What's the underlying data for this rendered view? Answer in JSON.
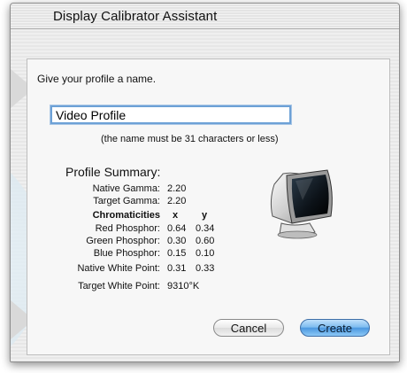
{
  "window": {
    "title": "Display Calibrator Assistant"
  },
  "form": {
    "prompt": "Give your profile a name.",
    "profile_name": "Video Profile",
    "hint": "(the name must be 31 characters or less)"
  },
  "summary": {
    "title": "Profile Summary:",
    "native_gamma_label": "Native Gamma:",
    "native_gamma_value": "2.20",
    "target_gamma_label": "Target Gamma:",
    "target_gamma_value": "2.20",
    "chromaticities_label": "Chromaticities",
    "x_header": "x",
    "y_header": "y",
    "phosphors": [
      {
        "label": "Red Phosphor:",
        "x": "0.64",
        "y": "0.34"
      },
      {
        "label": "Green Phosphor:",
        "x": "0.30",
        "y": "0.60"
      },
      {
        "label": "Blue Phosphor:",
        "x": "0.15",
        "y": "0.10"
      }
    ],
    "native_white_label": "Native White Point:",
    "native_white_x": "0.31",
    "native_white_y": "0.33",
    "target_white_label": "Target White Point:",
    "target_white_value": "9310°K"
  },
  "buttons": {
    "cancel": "Cancel",
    "create": "Create"
  },
  "icons": {
    "monitor": "crt-monitor-icon"
  }
}
